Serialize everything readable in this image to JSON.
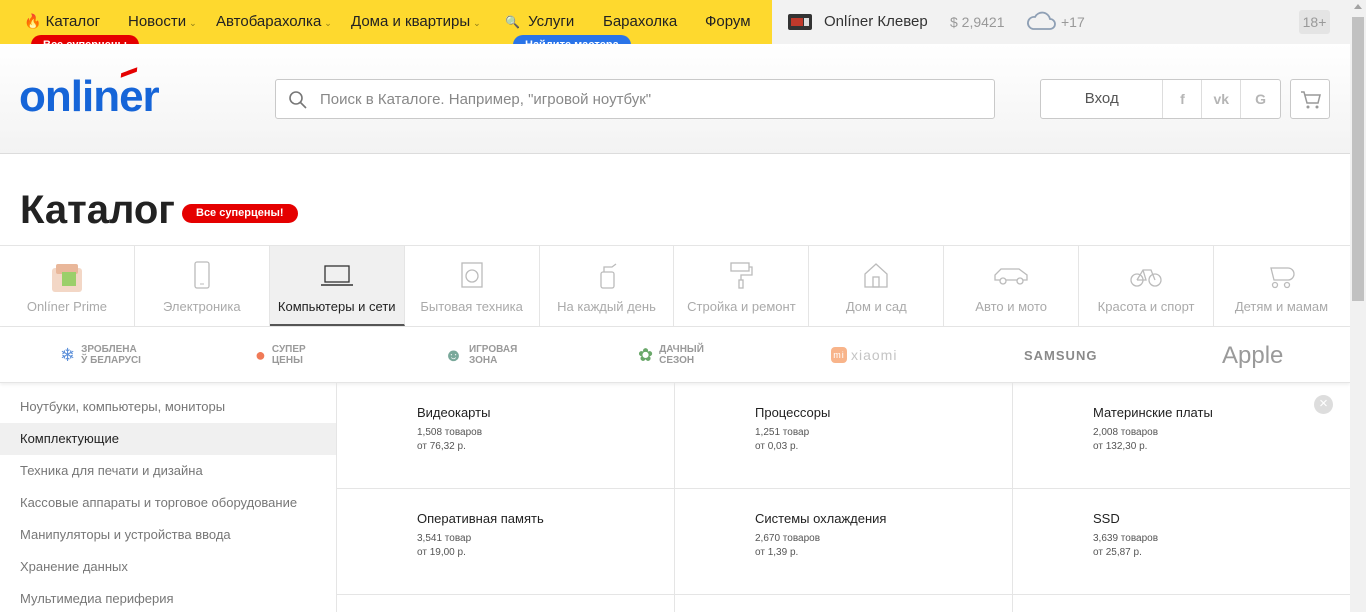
{
  "topnav": {
    "items": [
      {
        "label": "Каталог",
        "icon": "flame-icon"
      },
      {
        "label": "Новости"
      },
      {
        "label": "Автобарахолка"
      },
      {
        "label": "Дома и квартиры"
      },
      {
        "label": "Услуги",
        "icon": "magnifier-icon"
      },
      {
        "label": "Барахолка"
      },
      {
        "label": "Форум"
      }
    ],
    "catalog_pill": "Все суперцены",
    "services_pill": "Найдите мастера",
    "clever_label": "Onlíner Клевер",
    "currency": "$ 2,9421",
    "temperature": "+17",
    "age_badge": "18+"
  },
  "header": {
    "logo": "onliner",
    "search_placeholder": "Поиск в Каталоге. Например, \"игровой ноутбук\"",
    "login_label": "Вход",
    "social": [
      "f",
      "vk",
      "G"
    ]
  },
  "catalog": {
    "title": "Каталог",
    "pill": "Все суперцены!",
    "categories": [
      "Onlíner Prime",
      "Электроника",
      "Компьютеры и сети",
      "Бытовая техника",
      "На каждый день",
      "Стройка и ремонт",
      "Дом и сад",
      "Авто и мото",
      "Красота и спорт",
      "Детям и мамам"
    ],
    "active_category": "Компьютеры и сети",
    "brands": [
      {
        "line1": "ЗРОБЛЕНА",
        "line2": "Ў БЕЛАРУСІ"
      },
      {
        "line1": "СУПЕР",
        "line2": "ЦЕНЫ"
      },
      {
        "line1": "ИГРОВАЯ",
        "line2": "ЗОНА"
      },
      {
        "line1": "ДАЧНЫЙ",
        "line2": "СЕЗОН"
      },
      {
        "line1": "xiaomi",
        "line2": ""
      },
      {
        "line1": "SAMSUNG",
        "line2": ""
      },
      {
        "line1": "Apple",
        "line2": ""
      }
    ],
    "sidebar": [
      "Ноутбуки, компьютеры, мониторы",
      "Комплектующие",
      "Техника для печати и дизайна",
      "Кассовые аппараты и торговое оборудование",
      "Манипуляторы и устройства ввода",
      "Хранение данных",
      "Мультимедиа периферия"
    ],
    "active_sidebar": "Комплектующие",
    "products": [
      {
        "name": "Видеокарты",
        "count": "1,508 товаров",
        "price": "от 76,32 р."
      },
      {
        "name": "Процессоры",
        "count": "1,251 товар",
        "price": "от 0,03 р."
      },
      {
        "name": "Материнские платы",
        "count": "2,008 товаров",
        "price": "от 132,30 р."
      },
      {
        "name": "Оперативная память",
        "count": "3,541 товар",
        "price": "от 19,00 р."
      },
      {
        "name": "Системы охлаждения",
        "count": "2,670 товаров",
        "price": "от 1,39 р."
      },
      {
        "name": "SSD",
        "count": "3,639 товаров",
        "price": "от 25,87 р."
      }
    ]
  },
  "colors": {
    "nav_yellow": "#fed92e",
    "brand_blue": "#1665d8",
    "accent_red": "#e50000",
    "pill_blue": "#2a74e8"
  }
}
